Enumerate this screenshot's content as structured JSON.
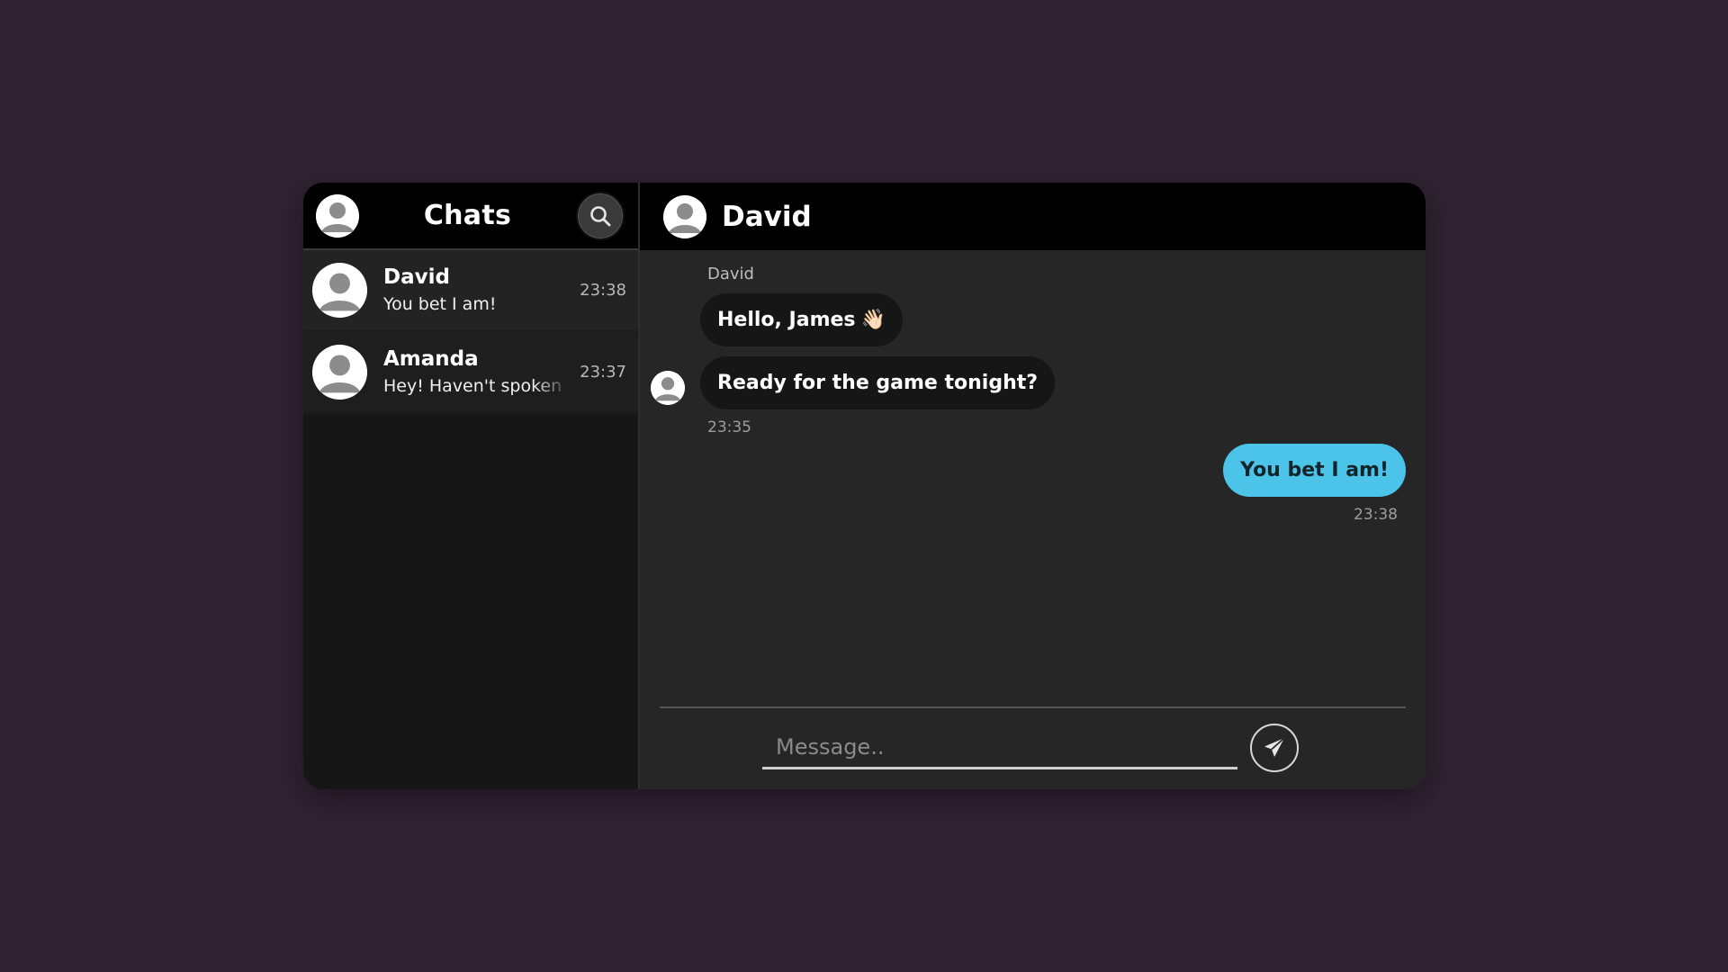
{
  "sidebar": {
    "title": "Chats",
    "chats": [
      {
        "name": "David",
        "preview": "You bet I am!",
        "time": "23:38"
      },
      {
        "name": "Amanda",
        "preview": "Hey! Haven't spoken",
        "time": "23:37"
      }
    ]
  },
  "conversation": {
    "contact_name": "David",
    "messages": [
      {
        "direction": "incoming",
        "sender": "David",
        "text": "Hello, James",
        "emoji": "👋🏻"
      },
      {
        "direction": "incoming",
        "text": "Ready for the game tonight?",
        "time": "23:35"
      },
      {
        "direction": "outgoing",
        "text": "You bet I am!",
        "time": "23:38"
      }
    ]
  },
  "composer": {
    "placeholder": "Message.."
  },
  "icons": {
    "profile": "user-avatar-icon",
    "search": "search-icon",
    "send": "paper-plane-icon"
  },
  "colors": {
    "background": "#2f2231",
    "header": "#000000",
    "sidebar": "#161616",
    "chat_panel": "#262626",
    "incoming_bubble": "#161616",
    "outgoing_bubble": "#4cc3e8"
  }
}
